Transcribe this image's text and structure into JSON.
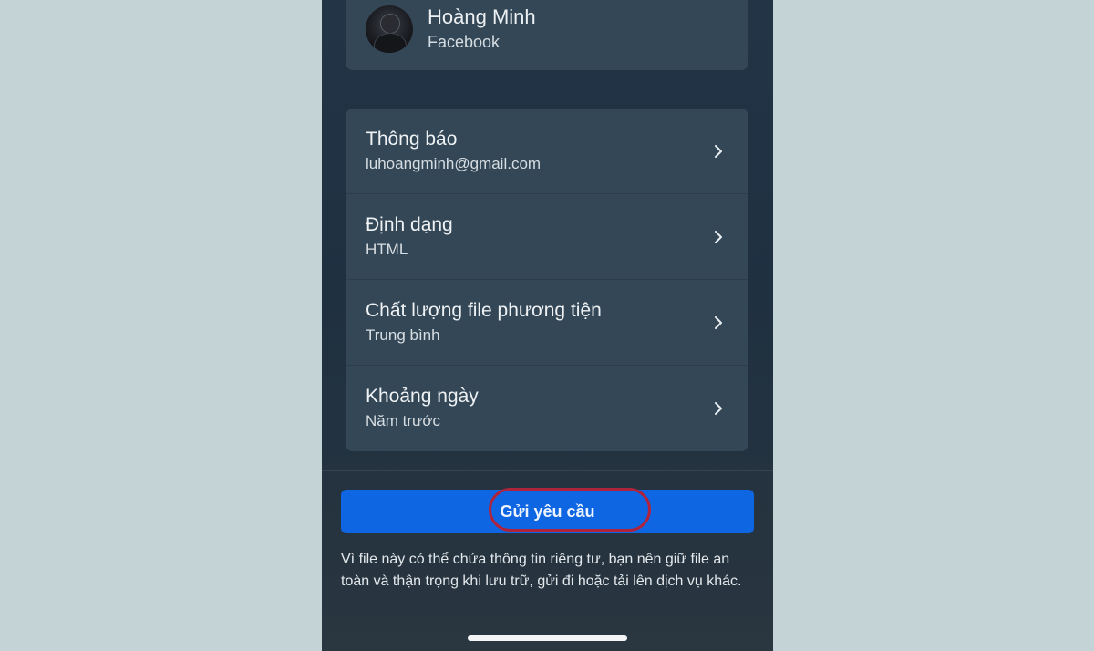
{
  "account": {
    "name": "Hoàng Minh",
    "platform": "Facebook"
  },
  "settings": [
    {
      "title": "Thông báo",
      "value": "luhoangminh@gmail.com"
    },
    {
      "title": "Định dạng",
      "value": "HTML"
    },
    {
      "title": "Chất lượng file phương tiện",
      "value": "Trung bình"
    },
    {
      "title": "Khoảng ngày",
      "value": "Năm trước"
    }
  ],
  "submit": {
    "label": "Gửi yêu cầu"
  },
  "disclaimer": "Vì file này có thể chứa thông tin riêng tư, bạn nên giữ file an toàn và thận trọng khi lưu trữ, gửi đi hoặc tải lên dịch vụ khác.",
  "colors": {
    "background": "#c3d3d6",
    "card": "#344756",
    "accent": "#0f66e3",
    "highlight": "#b0233c"
  },
  "icons": {
    "chevron": "chevron-right-icon",
    "avatar": "profile-photo"
  }
}
